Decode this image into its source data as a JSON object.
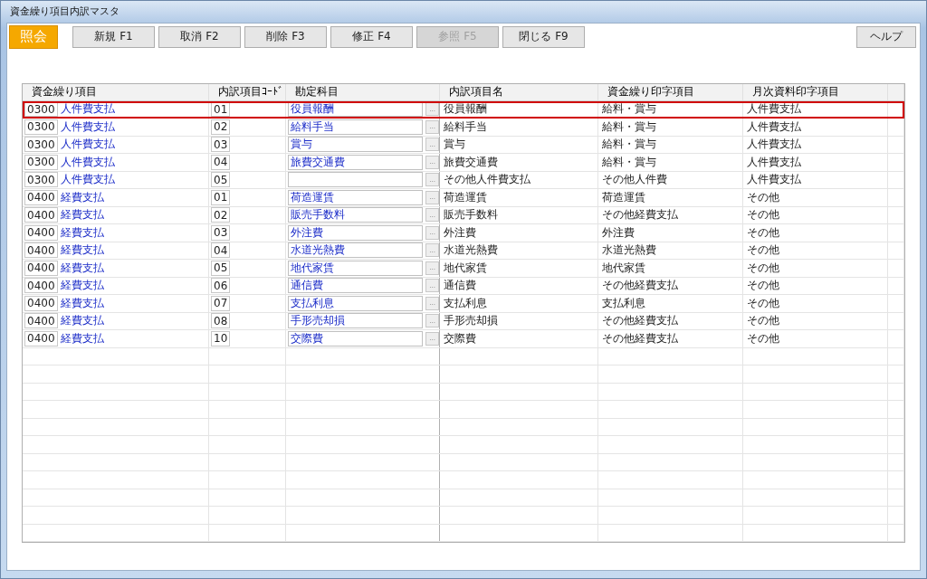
{
  "window": {
    "title": "資金繰り項目内訳マスタ"
  },
  "mode": "照会",
  "toolbar": [
    {
      "label": "新規 F1",
      "disabled": false
    },
    {
      "label": "取消 F2",
      "disabled": false
    },
    {
      "label": "削除 F3",
      "disabled": false
    },
    {
      "label": "修正 F4",
      "disabled": false
    },
    {
      "label": "参照 F5",
      "disabled": true
    },
    {
      "label": "閉じる F9",
      "disabled": false
    }
  ],
  "help_button": "ヘルプ",
  "table": {
    "columns": [
      "資金繰り項目",
      "内訳項目ｺｰﾄﾞ",
      "勘定科目",
      "内訳項目名",
      "資金繰り印字項目",
      "月次資料印字項目"
    ],
    "rows": [
      {
        "item_code": "0300",
        "item_name": "人件費支払",
        "sub_code": "01",
        "account": "役員報酬",
        "lookup_button": "...",
        "sub_name": "役員報酬",
        "cash_print": "給料・賞与",
        "monthly_print": "人件費支払",
        "selected": true
      },
      {
        "item_code": "0300",
        "item_name": "人件費支払",
        "sub_code": "02",
        "account": "給料手当",
        "lookup_button": "...",
        "sub_name": "給料手当",
        "cash_print": "給料・賞与",
        "monthly_print": "人件費支払",
        "selected": false
      },
      {
        "item_code": "0300",
        "item_name": "人件費支払",
        "sub_code": "03",
        "account": "賞与",
        "lookup_button": "...",
        "sub_name": "賞与",
        "cash_print": "給料・賞与",
        "monthly_print": "人件費支払",
        "selected": false
      },
      {
        "item_code": "0300",
        "item_name": "人件費支払",
        "sub_code": "04",
        "account": "旅費交通費",
        "lookup_button": "...",
        "sub_name": "旅費交通費",
        "cash_print": "給料・賞与",
        "monthly_print": "人件費支払",
        "selected": false
      },
      {
        "item_code": "0300",
        "item_name": "人件費支払",
        "sub_code": "05",
        "lookup_button": "...",
        "sub_name": "その他人件費支払",
        "cash_print": "その他人件費",
        "monthly_print": "人件費支払",
        "selected": false
      },
      {
        "item_code": "0400",
        "item_name": "経費支払",
        "sub_code": "01",
        "account": "荷造運賃",
        "lookup_button": "...",
        "sub_name": "荷造運賃",
        "cash_print": "荷造運賃",
        "monthly_print": "その他",
        "selected": false
      },
      {
        "item_code": "0400",
        "item_name": "経費支払",
        "sub_code": "02",
        "account": "販売手数料",
        "lookup_button": "...",
        "sub_name": "販売手数料",
        "cash_print": "その他経費支払",
        "monthly_print": "その他",
        "selected": false
      },
      {
        "item_code": "0400",
        "item_name": "経費支払",
        "sub_code": "03",
        "account": "外注費",
        "lookup_button": "...",
        "sub_name": "外注費",
        "cash_print": "外注費",
        "monthly_print": "その他",
        "selected": false
      },
      {
        "item_code": "0400",
        "item_name": "経費支払",
        "sub_code": "04",
        "account": "水道光熱費",
        "lookup_button": "...",
        "sub_name": "水道光熱費",
        "cash_print": "水道光熱費",
        "monthly_print": "その他",
        "selected": false
      },
      {
        "item_code": "0400",
        "item_name": "経費支払",
        "sub_code": "05",
        "account": "地代家賃",
        "lookup_button": "...",
        "sub_name": "地代家賃",
        "cash_print": "地代家賃",
        "monthly_print": "その他",
        "selected": false
      },
      {
        "item_code": "0400",
        "item_name": "経費支払",
        "sub_code": "06",
        "account": "通信費",
        "lookup_button": "...",
        "sub_name": "通信費",
        "cash_print": "その他経費支払",
        "monthly_print": "その他",
        "selected": false
      },
      {
        "item_code": "0400",
        "item_name": "経費支払",
        "sub_code": "07",
        "account": "支払利息",
        "lookup_button": "...",
        "sub_name": "支払利息",
        "cash_print": "支払利息",
        "monthly_print": "その他",
        "selected": false
      },
      {
        "item_code": "0400",
        "item_name": "経費支払",
        "sub_code": "08",
        "account": "手形売却損",
        "lookup_button": "...",
        "sub_name": "手形売却損",
        "cash_print": "その他経費支払",
        "monthly_print": "その他",
        "selected": false
      },
      {
        "item_code": "0400",
        "item_name": "経費支払",
        "sub_code": "10",
        "account": "交際費",
        "lookup_button": "...",
        "sub_name": "交際費",
        "cash_print": "その他経費支払",
        "monthly_print": "その他",
        "selected": false
      }
    ]
  }
}
